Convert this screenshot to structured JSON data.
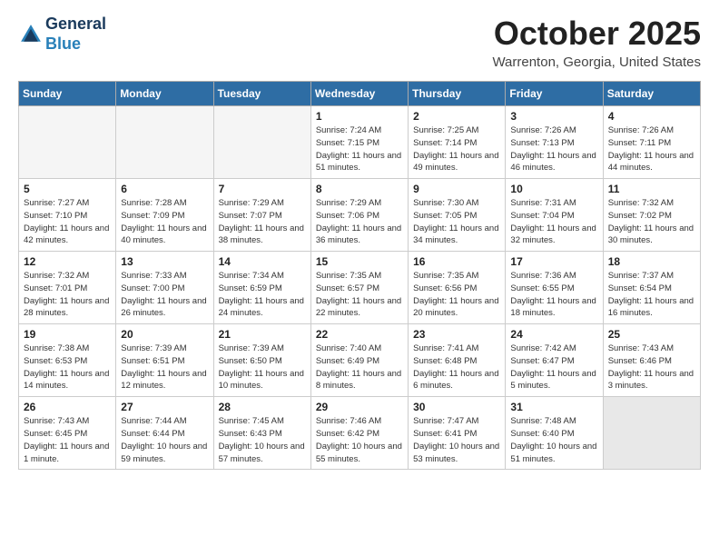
{
  "header": {
    "logo_line1": "General",
    "logo_line2": "Blue",
    "month": "October 2025",
    "location": "Warrenton, Georgia, United States"
  },
  "days_of_week": [
    "Sunday",
    "Monday",
    "Tuesday",
    "Wednesday",
    "Thursday",
    "Friday",
    "Saturday"
  ],
  "weeks": [
    [
      {
        "day": "",
        "empty": true
      },
      {
        "day": "",
        "empty": true
      },
      {
        "day": "",
        "empty": true
      },
      {
        "day": "1",
        "sunrise": "7:24 AM",
        "sunset": "7:15 PM",
        "daylight": "11 hours and 51 minutes."
      },
      {
        "day": "2",
        "sunrise": "7:25 AM",
        "sunset": "7:14 PM",
        "daylight": "11 hours and 49 minutes."
      },
      {
        "day": "3",
        "sunrise": "7:26 AM",
        "sunset": "7:13 PM",
        "daylight": "11 hours and 46 minutes."
      },
      {
        "day": "4",
        "sunrise": "7:26 AM",
        "sunset": "7:11 PM",
        "daylight": "11 hours and 44 minutes."
      }
    ],
    [
      {
        "day": "5",
        "sunrise": "7:27 AM",
        "sunset": "7:10 PM",
        "daylight": "11 hours and 42 minutes."
      },
      {
        "day": "6",
        "sunrise": "7:28 AM",
        "sunset": "7:09 PM",
        "daylight": "11 hours and 40 minutes."
      },
      {
        "day": "7",
        "sunrise": "7:29 AM",
        "sunset": "7:07 PM",
        "daylight": "11 hours and 38 minutes."
      },
      {
        "day": "8",
        "sunrise": "7:29 AM",
        "sunset": "7:06 PM",
        "daylight": "11 hours and 36 minutes."
      },
      {
        "day": "9",
        "sunrise": "7:30 AM",
        "sunset": "7:05 PM",
        "daylight": "11 hours and 34 minutes."
      },
      {
        "day": "10",
        "sunrise": "7:31 AM",
        "sunset": "7:04 PM",
        "daylight": "11 hours and 32 minutes."
      },
      {
        "day": "11",
        "sunrise": "7:32 AM",
        "sunset": "7:02 PM",
        "daylight": "11 hours and 30 minutes."
      }
    ],
    [
      {
        "day": "12",
        "sunrise": "7:32 AM",
        "sunset": "7:01 PM",
        "daylight": "11 hours and 28 minutes."
      },
      {
        "day": "13",
        "sunrise": "7:33 AM",
        "sunset": "7:00 PM",
        "daylight": "11 hours and 26 minutes."
      },
      {
        "day": "14",
        "sunrise": "7:34 AM",
        "sunset": "6:59 PM",
        "daylight": "11 hours and 24 minutes."
      },
      {
        "day": "15",
        "sunrise": "7:35 AM",
        "sunset": "6:57 PM",
        "daylight": "11 hours and 22 minutes."
      },
      {
        "day": "16",
        "sunrise": "7:35 AM",
        "sunset": "6:56 PM",
        "daylight": "11 hours and 20 minutes."
      },
      {
        "day": "17",
        "sunrise": "7:36 AM",
        "sunset": "6:55 PM",
        "daylight": "11 hours and 18 minutes."
      },
      {
        "day": "18",
        "sunrise": "7:37 AM",
        "sunset": "6:54 PM",
        "daylight": "11 hours and 16 minutes."
      }
    ],
    [
      {
        "day": "19",
        "sunrise": "7:38 AM",
        "sunset": "6:53 PM",
        "daylight": "11 hours and 14 minutes."
      },
      {
        "day": "20",
        "sunrise": "7:39 AM",
        "sunset": "6:51 PM",
        "daylight": "11 hours and 12 minutes."
      },
      {
        "day": "21",
        "sunrise": "7:39 AM",
        "sunset": "6:50 PM",
        "daylight": "11 hours and 10 minutes."
      },
      {
        "day": "22",
        "sunrise": "7:40 AM",
        "sunset": "6:49 PM",
        "daylight": "11 hours and 8 minutes."
      },
      {
        "day": "23",
        "sunrise": "7:41 AM",
        "sunset": "6:48 PM",
        "daylight": "11 hours and 6 minutes."
      },
      {
        "day": "24",
        "sunrise": "7:42 AM",
        "sunset": "6:47 PM",
        "daylight": "11 hours and 5 minutes."
      },
      {
        "day": "25",
        "sunrise": "7:43 AM",
        "sunset": "6:46 PM",
        "daylight": "11 hours and 3 minutes."
      }
    ],
    [
      {
        "day": "26",
        "sunrise": "7:43 AM",
        "sunset": "6:45 PM",
        "daylight": "11 hours and 1 minute."
      },
      {
        "day": "27",
        "sunrise": "7:44 AM",
        "sunset": "6:44 PM",
        "daylight": "10 hours and 59 minutes."
      },
      {
        "day": "28",
        "sunrise": "7:45 AM",
        "sunset": "6:43 PM",
        "daylight": "10 hours and 57 minutes."
      },
      {
        "day": "29",
        "sunrise": "7:46 AM",
        "sunset": "6:42 PM",
        "daylight": "10 hours and 55 minutes."
      },
      {
        "day": "30",
        "sunrise": "7:47 AM",
        "sunset": "6:41 PM",
        "daylight": "10 hours and 53 minutes."
      },
      {
        "day": "31",
        "sunrise": "7:48 AM",
        "sunset": "6:40 PM",
        "daylight": "10 hours and 51 minutes."
      },
      {
        "day": "",
        "empty": true,
        "shaded": true
      }
    ]
  ]
}
